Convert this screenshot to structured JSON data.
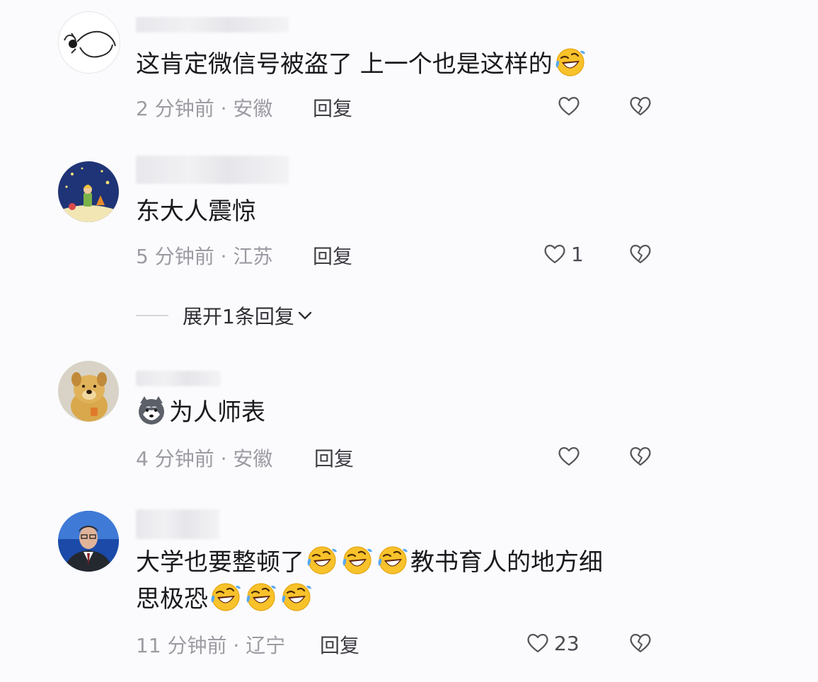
{
  "comments": [
    {
      "text_parts": [
        "这肯定微信号被盗了 上一个也是这样的"
      ],
      "time_location": "2 分钟前 · 安徽",
      "reply_label": "回复",
      "like_count": ""
    },
    {
      "text_parts": [
        "东大人震惊"
      ],
      "time_location": "5 分钟前 · 江苏",
      "reply_label": "回复",
      "like_count": "1"
    },
    {
      "text_parts": [
        "为人师表"
      ],
      "time_location": "4 分钟前 · 安徽",
      "reply_label": "回复",
      "like_count": ""
    },
    {
      "text_parts": [
        "大学也要整顿了",
        "教书育人的地方细",
        "思极恐"
      ],
      "time_location": "11 分钟前 · 辽宁",
      "reply_label": "回复",
      "like_count": "23"
    }
  ],
  "expand_replies": {
    "label": "展开1条回复"
  },
  "icons": {
    "like": "heart-outline-icon",
    "dislike": "broken-heart-icon",
    "laugh_emoji": "rolling-laughing-emoji",
    "dog_emoji": "husky-dog-emoji",
    "expand": "chevron-down-icon"
  },
  "colors": {
    "background": "#fbfbfd",
    "meta_text": "#9b9ba3",
    "emoji_yellow": "#f8c22a",
    "tear_blue": "#5aa8f0"
  }
}
